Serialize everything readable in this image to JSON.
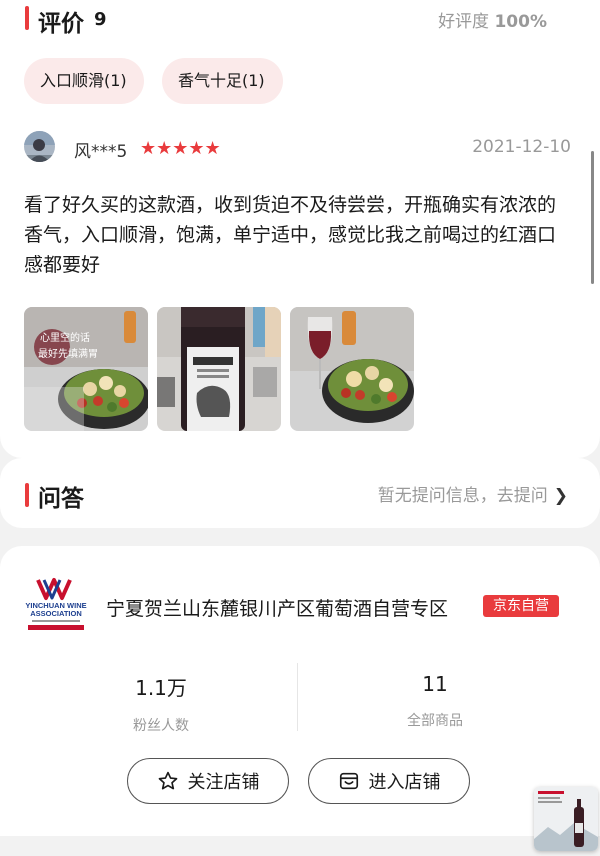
{
  "review_section": {
    "title": "评价",
    "count": "9",
    "good_rate_label": "好评度",
    "good_rate_value": "100%",
    "tags": [
      "入口顺滑(1)",
      "香气十足(1)"
    ],
    "review": {
      "username": "风***5",
      "stars": "★★★★★",
      "rating": 5,
      "date": "2021-12-10",
      "text": "看了好久买的这款酒，收到货迫不及待尝尝，开瓶确实有浓浓的香气，入口顺滑，饱满，单宁适中，感觉比我之前喝过的红酒口感都要好",
      "photo_1_caption": "心里空的话\n最好先填满胃"
    }
  },
  "qa_section": {
    "title": "问答",
    "hint": "暂无提问信息，去提问",
    "chevron": "❯"
  },
  "shop": {
    "logo_text_1": "YINCHUAN WINE",
    "logo_text_2": "ASSOCIATION",
    "name": "宁夏贺兰山东麓银川产区葡萄酒自营专区",
    "badge": "京东自营",
    "fans_value": "1.1万",
    "fans_label": "粉丝人数",
    "goods_value": "11",
    "goods_label": "全部商品",
    "follow_label": "关注店铺",
    "enter_label": "进入店铺"
  },
  "colors": {
    "accent": "#e93b3d",
    "tag_bg": "#fbeaea",
    "muted_text": "#999999",
    "page_bg": "#f2f2f2"
  },
  "icons": [
    "star-outline-icon",
    "shop-icon",
    "chevron-right-icon"
  ]
}
